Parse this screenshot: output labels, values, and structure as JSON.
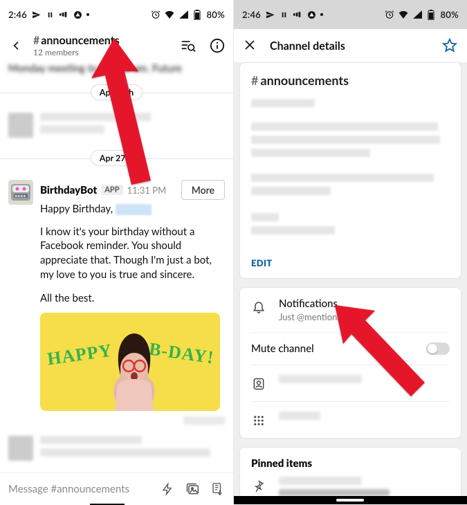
{
  "status": {
    "time": "2:46",
    "battery": "80%"
  },
  "left": {
    "channel_name": "announcements",
    "members": "12 members",
    "top_fragment": "Monday meeting to Tue 10 am. Future",
    "date1": "Apr 15th",
    "date2": "Apr 27th",
    "msg": {
      "author": "BirthdayBot",
      "tag": "APP",
      "time": "11:31 PM",
      "more": "More",
      "line1": "Happy Birthday,",
      "body": "I know it's your birthday without a Facebook reminder. You should appreciate that. Though I'm just a bot, my love to you is true and sincere.",
      "sign": "All the best.",
      "gif_word1": "HAPPY",
      "gif_word2": "B-DAY!"
    },
    "composer_placeholder": "Message #announcements"
  },
  "right": {
    "title": "Channel details",
    "channel_name": "announcements",
    "edit": "EDIT",
    "notif_title": "Notifications",
    "notif_sub": "Just @mentions",
    "mute": "Mute channel",
    "pinned": "Pinned items"
  }
}
